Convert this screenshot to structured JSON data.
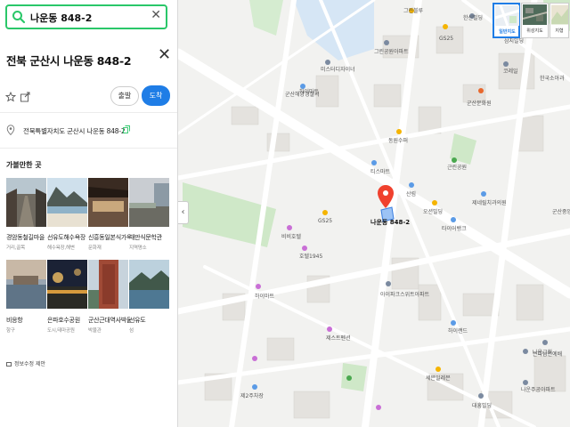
{
  "search": {
    "value": "나운동 848-2"
  },
  "place": {
    "title": "전북 군산시 나운동 848-2",
    "address": "전북특별자치도 군산시 나운동 848-2",
    "depart_label": "출발",
    "arrive_label": "도착"
  },
  "nearby": {
    "title": "가볼만한 곳",
    "items": [
      {
        "name": "경암동철길마을",
        "category": "거리,골목"
      },
      {
        "name": "선유도해수욕장",
        "category": "해수욕장,해변"
      },
      {
        "name": "신흥동일본식가옥",
        "category": "문화재"
      },
      {
        "name": "채만식문학관",
        "category": "지역명소"
      },
      {
        "name": "비응항",
        "category": "항구"
      },
      {
        "name": "은파호수공원",
        "category": "도시,테마공원"
      },
      {
        "name": "군산근대역사박물관",
        "category": "박물관"
      },
      {
        "name": "선유도",
        "category": "섬"
      }
    ]
  },
  "report_label": "정보수정 제안",
  "map_types": [
    {
      "label": "일반지도",
      "active": true
    },
    {
      "label": "위성지도",
      "active": false
    },
    {
      "label": "지형",
      "active": false
    }
  ],
  "map": {
    "marker_label": "나운동 848-2",
    "pois": [
      "그린블루",
      "한신빌딩",
      "삼지빌딩",
      "GS25",
      "그린공원아파트",
      "미스터디자이너",
      "군산해양경찰서",
      "하이마트",
      "한국소아과",
      "코레일",
      "군산문화원",
      "동원수퍼",
      "근린공원",
      "티스마트",
      "산림",
      "오션빌딩",
      "제네릴치과의원",
      "타이어뱅크",
      "군산중앙여자고",
      "GS25",
      "비비호텔",
      "호텔1945",
      "아이파크스위트아파트",
      "하이마트",
      "하이랜드",
      "세븐일레븐",
      "제스트펜션",
      "나운교회",
      "나운주공아파트",
      "은파남연예배",
      "대흥빌딩",
      "제2주차장"
    ]
  }
}
